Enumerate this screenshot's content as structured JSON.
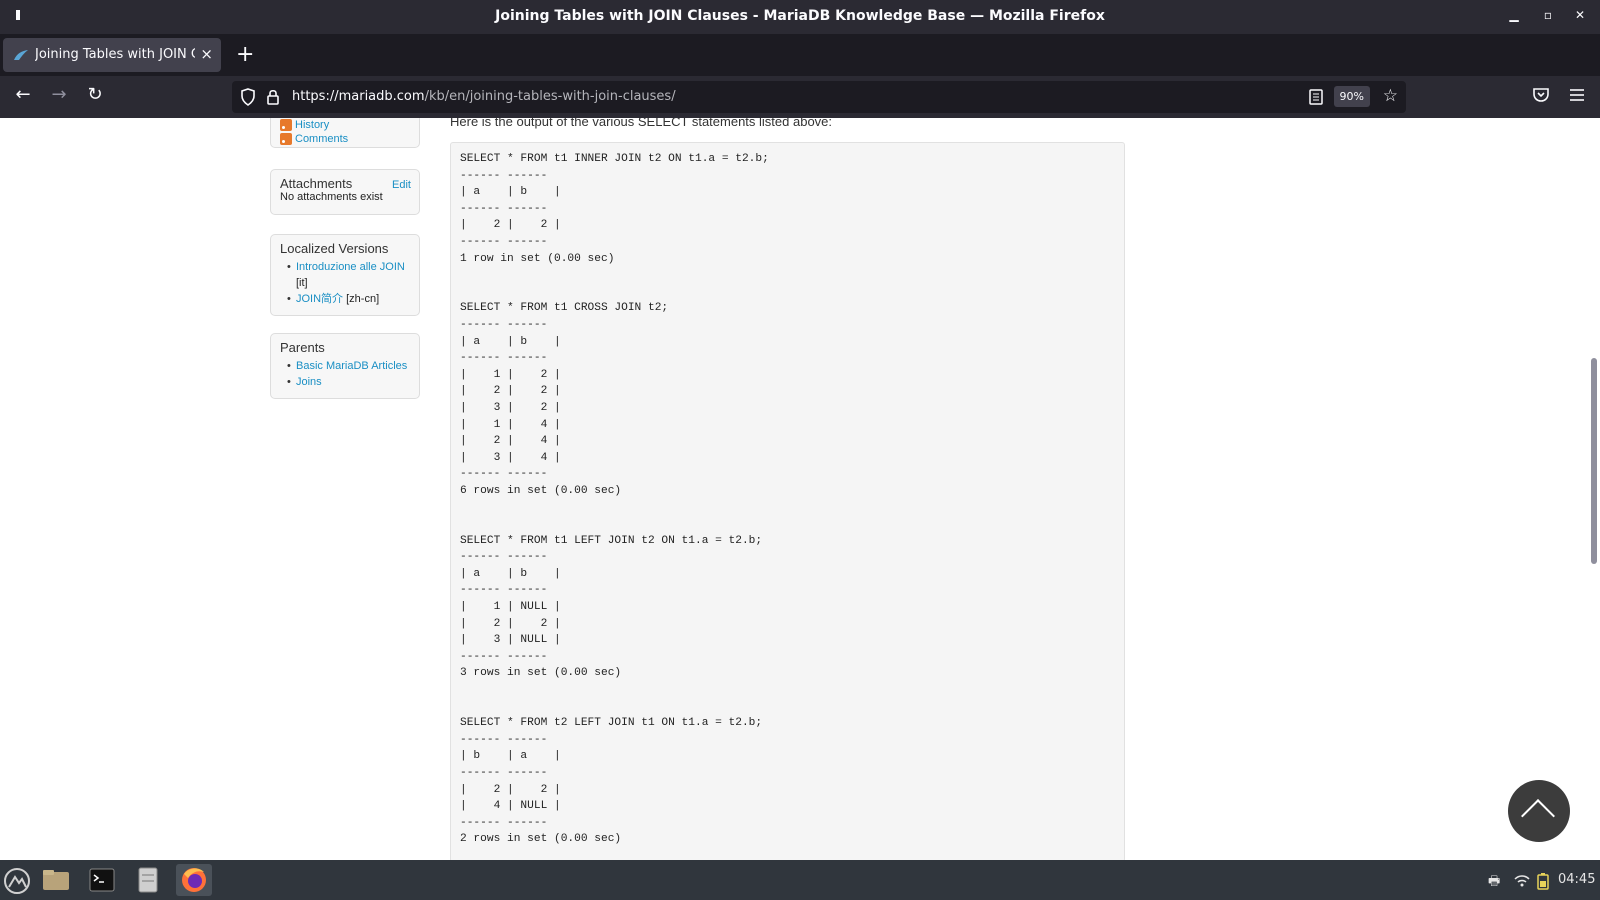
{
  "window": {
    "title": "Joining Tables with JOIN Clauses - MariaDB Knowledge Base — Mozilla Firefox"
  },
  "tab": {
    "label": "Joining Tables with JOIN Clauses - MariaDB Knowledge Base",
    "close": "×"
  },
  "newtab": "+",
  "nav": {
    "back": "←",
    "forward": "→",
    "reload": "↻",
    "url_host": "https://mariadb.com",
    "url_path": "/kb/en/joining-tables-with-join-clauses/",
    "zoom": "90%"
  },
  "sidebar": {
    "history_label": "History",
    "comments_label": "Comments",
    "attachments": {
      "title": "Attachments",
      "edit": "Edit",
      "text": "No attachments exist"
    },
    "localized": {
      "title": "Localized Versions",
      "items": [
        {
          "link": "Introduzione alle JOIN",
          "lang": "[it]"
        },
        {
          "link": "JOIN简介",
          "lang": "[zh-cn]"
        }
      ]
    },
    "parents": {
      "title": "Parents",
      "items": [
        "Basic MariaDB Articles",
        "Joins"
      ]
    }
  },
  "content": {
    "intro": "Here is the output of the various SELECT statements listed above:",
    "code": "SELECT * FROM t1 INNER JOIN t2 ON t1.a = t2.b;\n------ ------\n| a    | b    |\n------ ------\n|    2 |    2 |\n------ ------\n1 row in set (0.00 sec)\n\n\nSELECT * FROM t1 CROSS JOIN t2;\n------ ------\n| a    | b    |\n------ ------\n|    1 |    2 |\n|    2 |    2 |\n|    3 |    2 |\n|    1 |    4 |\n|    2 |    4 |\n|    3 |    4 |\n------ ------\n6 rows in set (0.00 sec)\n\n\nSELECT * FROM t1 LEFT JOIN t2 ON t1.a = t2.b;\n------ ------\n| a    | b    |\n------ ------\n|    1 | NULL |\n|    2 |    2 |\n|    3 | NULL |\n------ ------\n3 rows in set (0.00 sec)\n\n\nSELECT * FROM t2 LEFT JOIN t1 ON t1.a = t2.b;\n------ ------\n| b    | a    |\n------ ------\n|    2 |    2 |\n|    4 | NULL |\n------ ------\n2 rows in set (0.00 sec)"
  },
  "taskbar": {
    "clock": "04:45"
  },
  "colors": {
    "link": "#1a8fc4",
    "chrome_dark": "#2b2a33",
    "taskbar": "#30363d"
  }
}
